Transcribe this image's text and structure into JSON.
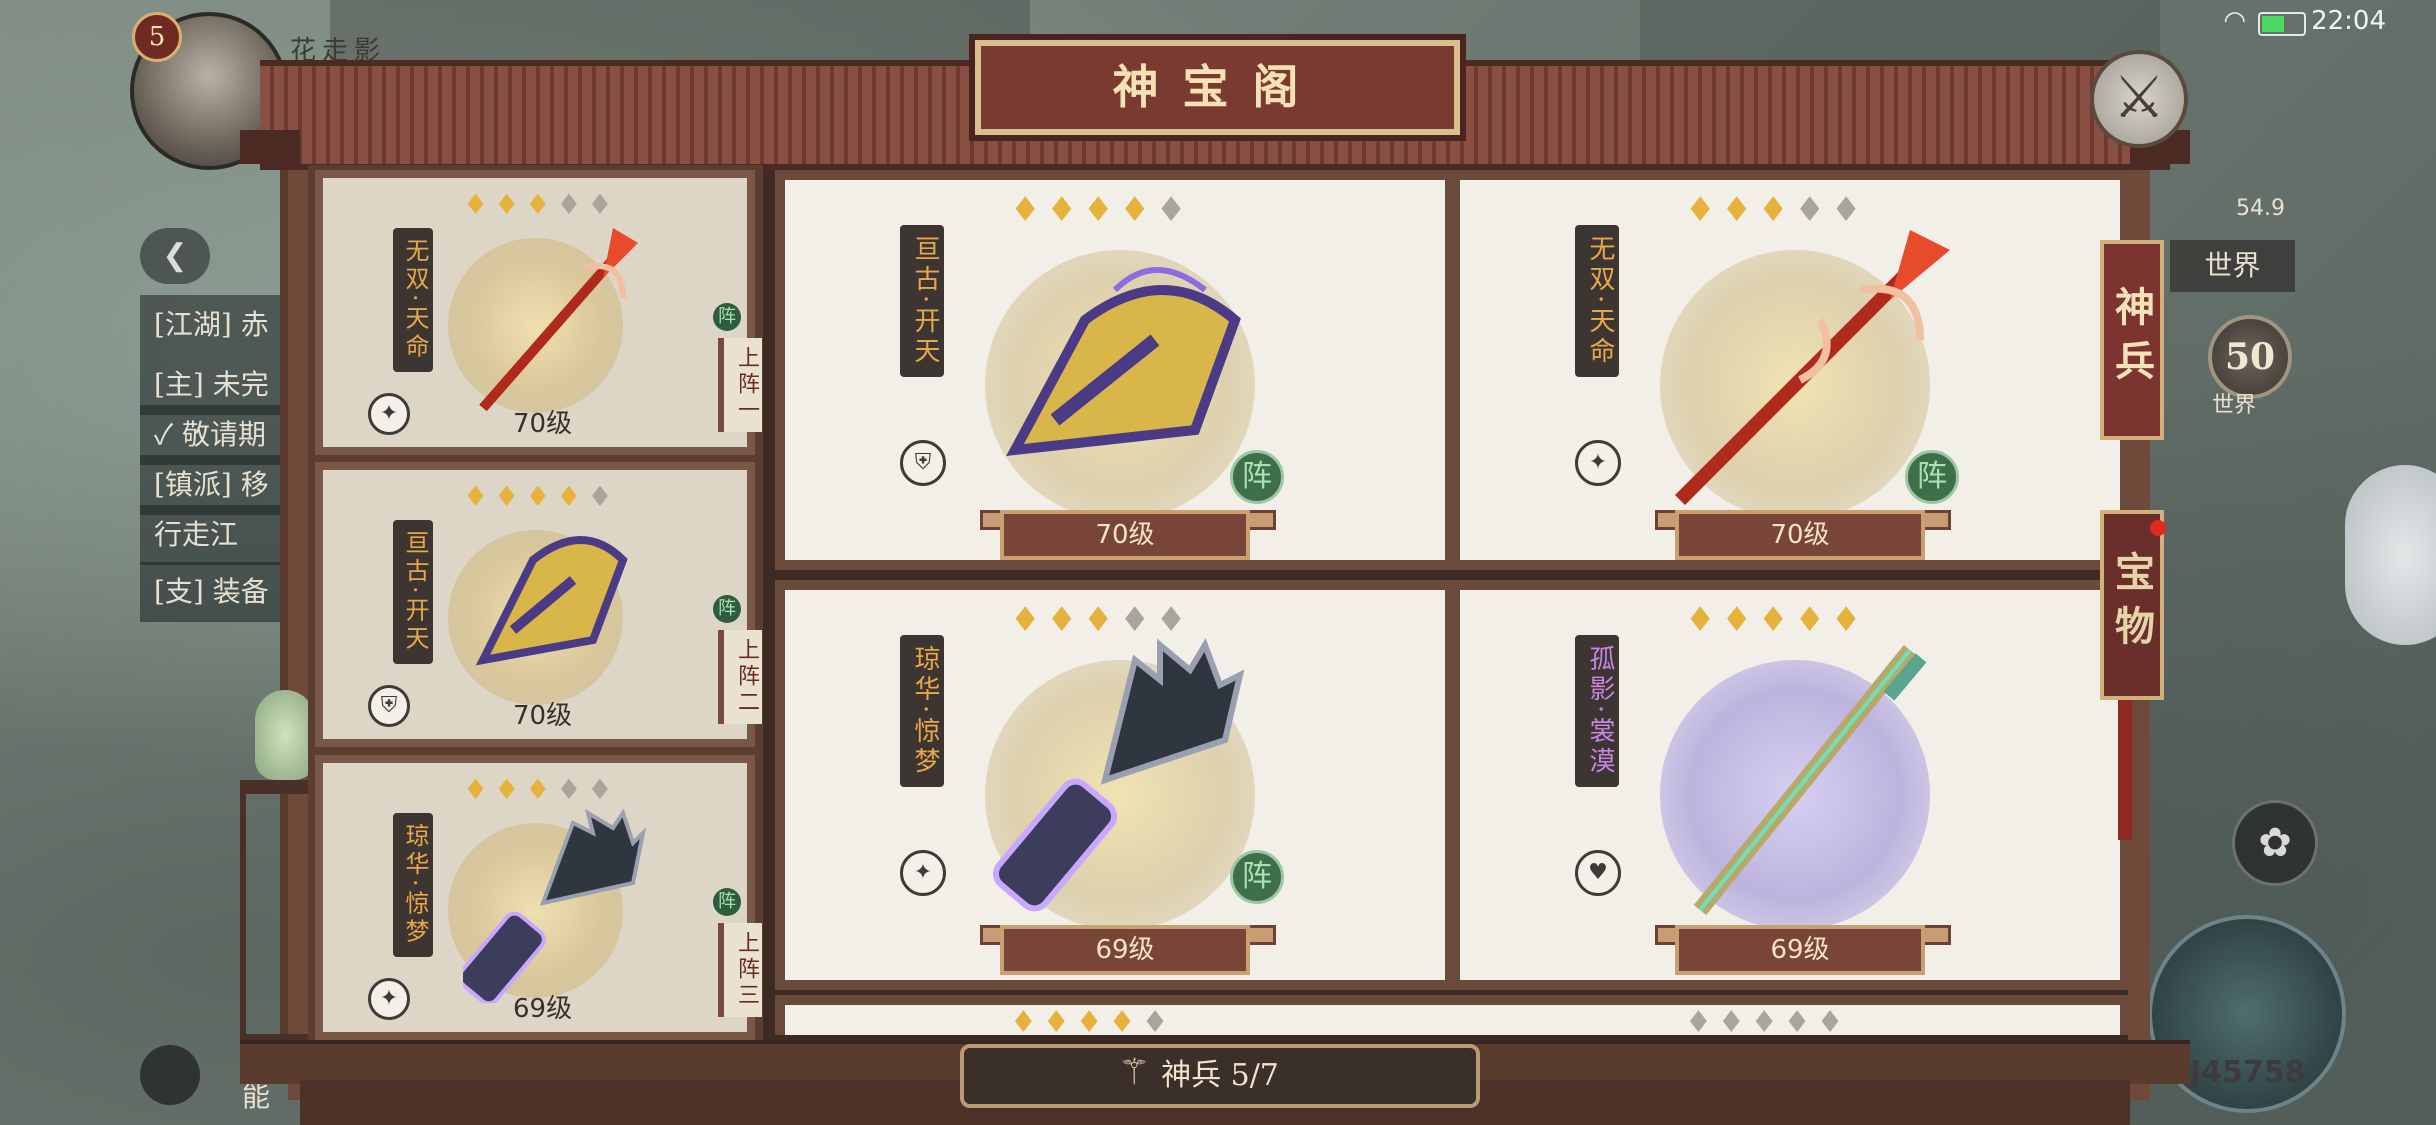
{
  "status": {
    "time": "22:04"
  },
  "player": {
    "level": "5",
    "name": "花走影"
  },
  "left_panel": {
    "rows": [
      "[江湖] 赤",
      "[主] 未完",
      "✓ 敬请期",
      "[镇派] 移",
      "行走江",
      "[支] 装备"
    ],
    "bottom": "能"
  },
  "right_hud": {
    "coord": "54.9",
    "world_tag": "世界",
    "world_level": "50",
    "world_level_label": "世界",
    "power": "J45758"
  },
  "dialog": {
    "title": "神宝阁",
    "close_icon": "crossed-swords-icon",
    "tabs": [
      {
        "label": "神兵",
        "active": true
      },
      {
        "label": "宝物",
        "active": false
      }
    ],
    "counter_label": "神兵 5/7"
  },
  "lineup": [
    {
      "name": "无双·天命",
      "stars_on": 3,
      "stars_total": 5,
      "level": "70级",
      "slot": "上阵一",
      "zhen": "阵",
      "weapon": "red-halberd"
    },
    {
      "name": "亘古·开天",
      "stars_on": 4,
      "stars_total": 5,
      "level": "70级",
      "slot": "上阵二",
      "zhen": "阵",
      "weapon": "gold-gauntlet"
    },
    {
      "name": "琼华·惊梦",
      "stars_on": 3,
      "stars_total": 5,
      "level": "69级",
      "slot": "上阵三",
      "zhen": "阵",
      "weapon": "feather-fan"
    }
  ],
  "grid": [
    {
      "name": "亘古·开天",
      "stars_on": 4,
      "stars_total": 5,
      "level": "70级",
      "zhen": "阵",
      "weapon": "gold-gauntlet",
      "color": "orange"
    },
    {
      "name": "无双·天命",
      "stars_on": 3,
      "stars_total": 5,
      "level": "70级",
      "zhen": "阵",
      "weapon": "red-halberd",
      "color": "orange"
    },
    {
      "name": "琼华·惊梦",
      "stars_on": 3,
      "stars_total": 5,
      "level": "69级",
      "zhen": "阵",
      "weapon": "feather-fan",
      "color": "orange"
    },
    {
      "name": "孤影·裳漠",
      "stars_on": 5,
      "stars_total": 5,
      "level": "69级",
      "zhen": "",
      "weapon": "jade-sword",
      "color": "purple"
    }
  ]
}
